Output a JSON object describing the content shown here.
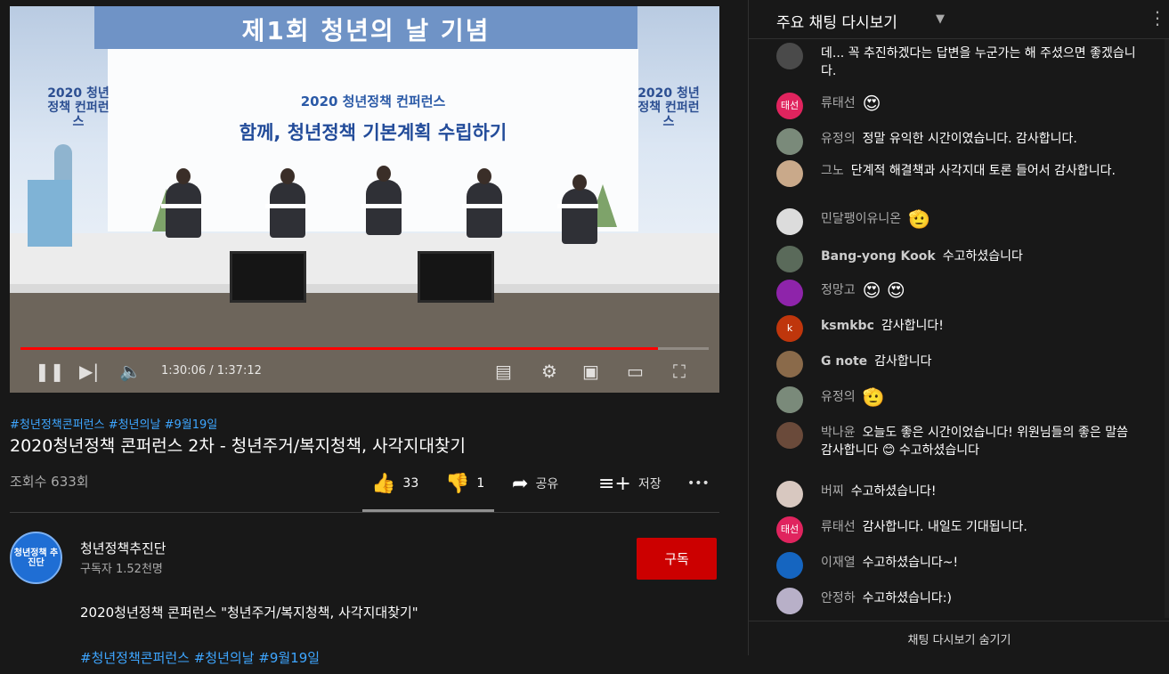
{
  "video": {
    "banner_text": "제1회 청년의 날 기념",
    "screen_line1": "2020 청년정책 컨퍼런스",
    "screen_line2": "함께, 청년정책 기본계획 수립하기",
    "side_text": "2020 청년정책 컨퍼런스",
    "time_display": "1:30:06 / 1:37:12",
    "progress": 0.926
  },
  "meta": {
    "hashtags": "#청년정책콘퍼런스 #청년의날 #9월19일",
    "title": "2020청년정책 콘퍼런스 2차 - 청년주거/복지청책, 사각지대찾기",
    "views": "조회수 633회",
    "likes": "33",
    "dislikes": "1",
    "share_label": "공유",
    "save_label": "저장",
    "more_label": "•••"
  },
  "channel": {
    "name": "청년정책추진단",
    "subscribers": "구독자 1.52천명",
    "avatar_text": "청년정책 추진단",
    "subscribe_label": "구독"
  },
  "description": {
    "text": "2020청년정책 콘퍼런스  \"청년주거/복지청책, 사각지대찾기\"",
    "tags": "#청년정책콘퍼런스 #청년의날 #9월19일"
  },
  "chat": {
    "title": "주요 채팅 다시보기",
    "footer_label": "채팅 다시보기 숨기기",
    "messages": [
      {
        "author": "",
        "text": "데... 꼭 추진하겠다는 답변을 누군가는 해 주셨으면 좋겠습니다.",
        "avatar": "",
        "color": "#4a4a4a"
      },
      {
        "author": "류태선",
        "text": "",
        "emoji": "😍",
        "avatar": "태선",
        "color": "#e0245e"
      },
      {
        "author": "유정의",
        "text": "정말 유익한 시간이였습니다. 감사합니다.",
        "avatar": "",
        "color": "#7a8a7a"
      },
      {
        "author": "그노",
        "text": "단계적 해결책과 사각지대 토론 들어서 감사합니다.",
        "avatar": "",
        "color": "#c9a98a"
      },
      {
        "author": "민달팽이유니온",
        "text": "",
        "emoji": "🫡",
        "avatar": "",
        "color": "#dcdcdc"
      },
      {
        "author": "Bang-yong Kook",
        "text": "수고하셨습니다",
        "avatar": "",
        "color": "#5a6a5a"
      },
      {
        "author": "정망고",
        "text": "",
        "emoji": "😍 😍",
        "avatar": "",
        "color": "#8e24aa"
      },
      {
        "author": "ksmkbc",
        "text": "감사합니다!",
        "avatar": "k",
        "color": "#bf360c"
      },
      {
        "author": "G note",
        "text": "감사합니다",
        "avatar": "",
        "color": "#8a6a4a"
      },
      {
        "author": "유정의",
        "text": "",
        "emoji": "🫡",
        "avatar": "",
        "color": "#7a8a7a"
      },
      {
        "author": "박나윤",
        "text": "오늘도 좋은 시간이었습니다! 위원님들의 좋은 말씀 감사합니다 😊 수고하셨습니다",
        "avatar": "",
        "color": "#6a4a3a"
      },
      {
        "author": "버찌",
        "text": "수고하셨습니다!",
        "avatar": "",
        "color": "#d8c8c0"
      },
      {
        "author": "류태선",
        "text": "감사합니다. 내일도 기대됩니다.",
        "avatar": "태선",
        "color": "#e0245e"
      },
      {
        "author": "이재열",
        "text": "수고하셨습니다~!",
        "avatar": "",
        "color": "#1565c0"
      },
      {
        "author": "안정하",
        "text": "수고하셨습니다:)",
        "avatar": "",
        "color": "#b8b0c8"
      }
    ]
  }
}
